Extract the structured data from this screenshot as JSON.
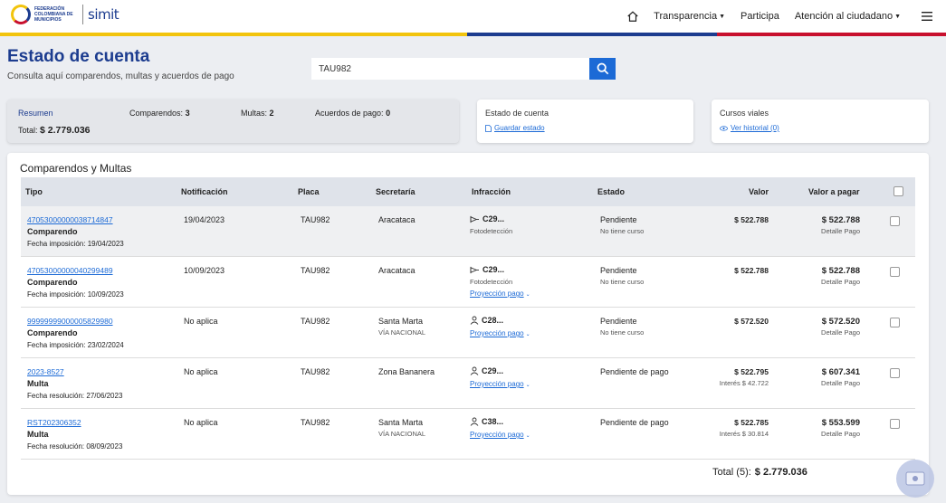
{
  "nav": {
    "logo_org": "FEDERACIÓN COLOMBIANA DE MUNICIPIOS",
    "logo_brand": "simit",
    "items": [
      {
        "label": "Transparencia",
        "has_caret": true
      },
      {
        "label": "Participa",
        "has_caret": false
      },
      {
        "label": "Atención al ciudadano",
        "has_caret": true
      }
    ],
    "icons": [
      "home-icon",
      "hamburger-menu-icon"
    ]
  },
  "colors": {
    "yellow": "#f2c40d",
    "blue": "#1c3c8f",
    "red": "#c8102e",
    "link": "#1c6ad6"
  },
  "header": {
    "title": "Estado de cuenta",
    "subtitle": "Consulta aquí comparendos, multas y acuerdos de pago"
  },
  "search": {
    "value": "TAU982"
  },
  "resumen": {
    "label": "Resumen",
    "comparendos_label": "Comparendos:",
    "comparendos_count": "3",
    "multas_label": "Multas:",
    "multas_count": "2",
    "acuerdos_label": "Acuerdos de pago:",
    "acuerdos_count": "0",
    "total_label": "Total:",
    "total_value": "$ 2.779.036"
  },
  "estado_card": {
    "title": "Estado de cuenta",
    "link": "Guardar estado"
  },
  "cursos_card": {
    "title": "Cursos viales",
    "link": "Ver historial (0)"
  },
  "table": {
    "title": "Comparendos y Multas",
    "headers": [
      "Tipo",
      "Notificación",
      "Placa",
      "Secretaría",
      "Infracción",
      "Estado",
      "Valor",
      "Valor a pagar"
    ],
    "rows": [
      {
        "numero": "47053000000038714847",
        "tipo": "Comparendo",
        "fecha": "Fecha imposición: 19/04/2023",
        "notificacion": "19/04/2023",
        "placa": "TAU982",
        "secretaria": "Aracataca",
        "secretaria_sub": "",
        "infraccion": "C29...",
        "infraccion_icon": "camera-icon",
        "infraccion_sub": "Fotodetección",
        "proyeccion": "",
        "estado": "Pendiente",
        "estado_sub": "No tiene curso",
        "valor": "$ 522.788",
        "valor_sub": "",
        "valor_pagar": "$ 522.788",
        "detalle": "Detalle Pago"
      },
      {
        "numero": "47053000000040299489",
        "tipo": "Comparendo",
        "fecha": "Fecha imposición: 10/09/2023",
        "notificacion": "10/09/2023",
        "placa": "TAU982",
        "secretaria": "Aracataca",
        "secretaria_sub": "",
        "infraccion": "C29...",
        "infraccion_icon": "camera-icon",
        "infraccion_sub": "Fotodetección",
        "proyeccion": "Proyección pago",
        "estado": "Pendiente",
        "estado_sub": "No tiene curso",
        "valor": "$ 522.788",
        "valor_sub": "",
        "valor_pagar": "$ 522.788",
        "detalle": "Detalle Pago"
      },
      {
        "numero": "99999999000005829980",
        "tipo": "Comparendo",
        "fecha": "Fecha imposición: 23/02/2024",
        "notificacion": "No aplica",
        "placa": "TAU982",
        "secretaria": "Santa Marta",
        "secretaria_sub": "VÍA NACIONAL",
        "infraccion": "C28...",
        "infraccion_icon": "person-icon",
        "infraccion_sub": "",
        "proyeccion": "Proyección pago",
        "estado": "Pendiente",
        "estado_sub": "No tiene curso",
        "valor": "$ 572.520",
        "valor_sub": "",
        "valor_pagar": "$ 572.520",
        "detalle": "Detalle Pago"
      },
      {
        "numero": "2023-8527",
        "tipo": "Multa",
        "fecha": "Fecha resolución: 27/06/2023",
        "notificacion": "No aplica",
        "placa": "TAU982",
        "secretaria": "Zona Bananera",
        "secretaria_sub": "",
        "infraccion": "C29...",
        "infraccion_icon": "person-icon",
        "infraccion_sub": "",
        "proyeccion": "Proyección pago",
        "estado": "Pendiente de pago",
        "estado_sub": "",
        "valor": "$ 522.795",
        "valor_sub": "Interés $ 42.722",
        "valor_pagar": "$ 607.341",
        "detalle": "Detalle Pago"
      },
      {
        "numero": "RST202306352",
        "tipo": "Multa",
        "fecha": "Fecha resolución: 08/09/2023",
        "notificacion": "No aplica",
        "placa": "TAU982",
        "secretaria": "Santa Marta",
        "secretaria_sub": "VÍA NACIONAL",
        "infraccion": "C38...",
        "infraccion_icon": "person-icon",
        "infraccion_sub": "",
        "proyeccion": "Proyección pago",
        "estado": "Pendiente de pago",
        "estado_sub": "",
        "valor": "$ 522.785",
        "valor_sub": "Interés $ 30.814",
        "valor_pagar": "$ 553.599",
        "detalle": "Detalle Pago"
      }
    ],
    "total_label": "Total (5):",
    "total_value": "$ 2.779.036"
  }
}
